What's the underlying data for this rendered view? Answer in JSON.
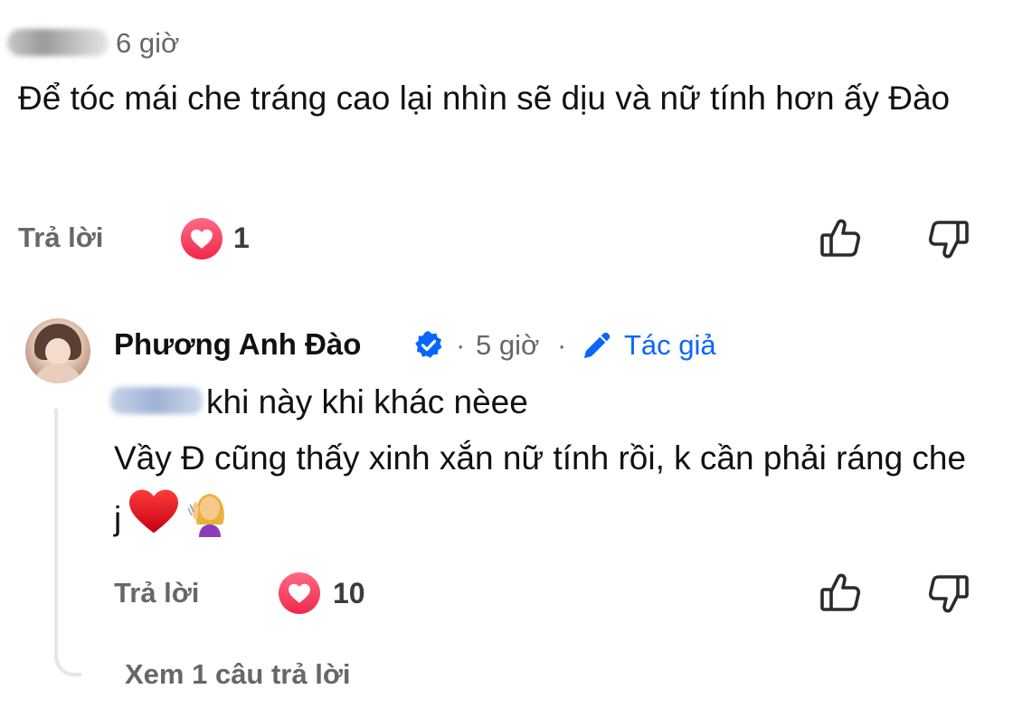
{
  "comment": {
    "time": "6 giờ",
    "text": "Để tóc mái che tráng cao lại nhìn sẽ dịu và nữ tính hơn ấy Đào",
    "reply_label": "Trả lời",
    "reaction_count": "1",
    "icons": {
      "reaction": "heart-reaction-icon",
      "like": "thumbs-up-icon",
      "dislike": "thumbs-down-icon"
    }
  },
  "reply": {
    "author": "Phương Anh Đào",
    "separator": "·",
    "time": "5 giờ",
    "author_badge": "Tác giả",
    "line1": "khi này khi khác nèee",
    "line2": "Vầy Đ cũng thấy xinh xắn nữ tính rồi, k cần phải ráng che j",
    "reply_label": "Trả lời",
    "reaction_count": "10",
    "view_replies": "Xem 1 câu trả lời",
    "icons": {
      "verified": "verified-badge-icon",
      "pencil": "pencil-icon",
      "emoji1": "red-heart-emoji",
      "emoji2": "woman-tipping-hand-emoji"
    }
  },
  "colors": {
    "accent": "#0866ff",
    "meta": "#65676b",
    "heart": "#f0284a",
    "thread": "#e4e6eb"
  }
}
